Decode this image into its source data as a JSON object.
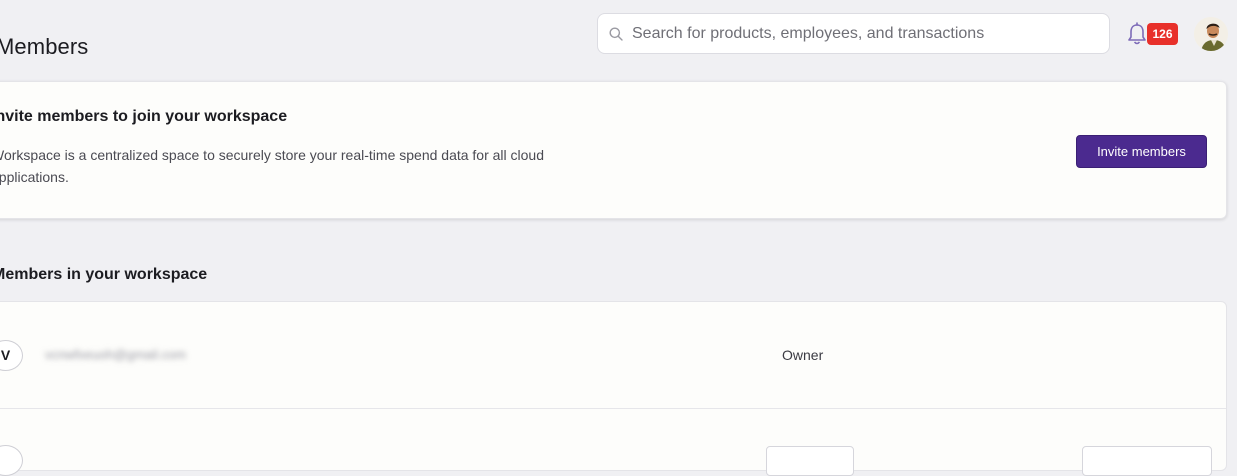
{
  "page": {
    "title": "Members"
  },
  "search": {
    "placeholder": "Search for products, employees, and transactions",
    "icon": "search-icon"
  },
  "notifications": {
    "icon": "bell-icon",
    "count": "126",
    "badge_color": "#e8302a"
  },
  "user": {
    "avatar": "user-avatar"
  },
  "invite_card": {
    "title": "Invite members to join your workspace",
    "description": "Workspace is a centralized space to securely store your real-time spend data for all cloud applications.",
    "button_label": "Invite members",
    "button_color": "#4b2a8f"
  },
  "members_section": {
    "title": "Members in your workspace",
    "rows": [
      {
        "initial": "V",
        "email": "vcnwfxeuoh@gmail.com",
        "role": "Owner"
      }
    ]
  }
}
